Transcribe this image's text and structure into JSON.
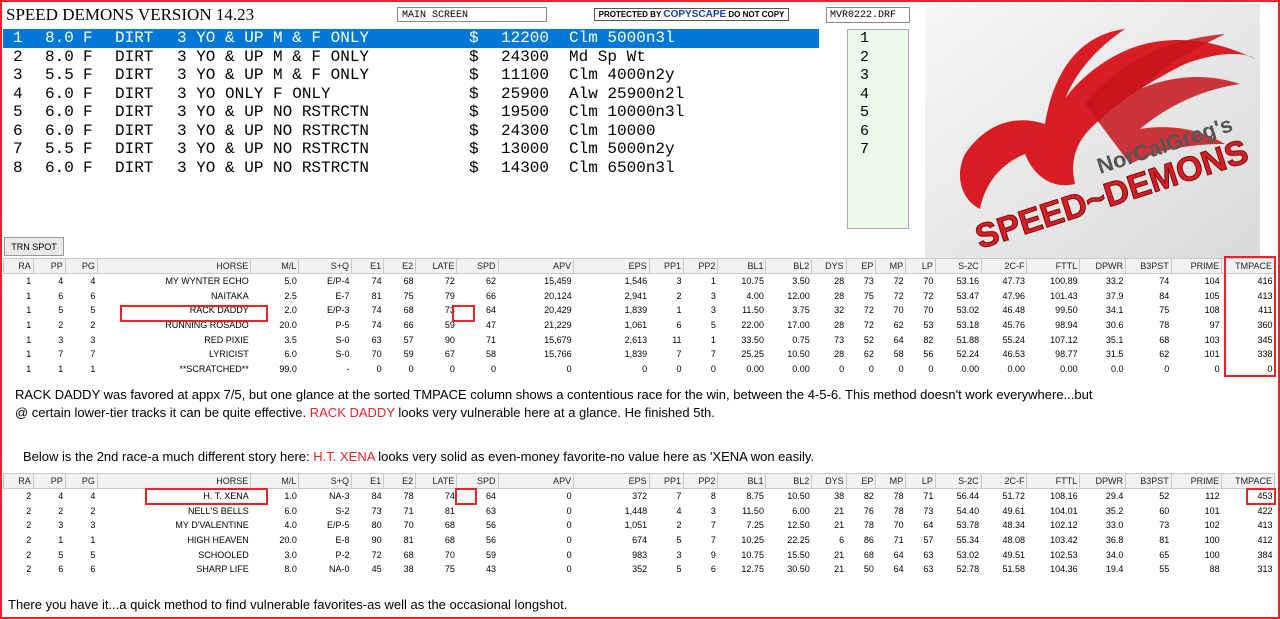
{
  "app": {
    "title": "SPEED DEMONS VERSION 14.23",
    "screen_label": "MAIN SCREEN",
    "protected_text_1": "PROTECTED BY ",
    "protected_brand": "COPYSCAPE",
    "protected_text_2": " DO NOT COPY",
    "file_name": "MVR0222.DRF"
  },
  "race_list": [
    {
      "num": "1",
      "dist": "8.0",
      "surf": "F",
      "track": "DIRT",
      "conditions": "3 YO & UP M & F ONLY",
      "cur": "$",
      "purse": "12200",
      "type": "Clm 5000n3l",
      "selected": true
    },
    {
      "num": "2",
      "dist": "8.0",
      "surf": "F",
      "track": "DIRT",
      "conditions": "3 YO & UP M & F ONLY",
      "cur": "$",
      "purse": "24300",
      "type": "Md Sp Wt",
      "selected": false
    },
    {
      "num": "3",
      "dist": "5.5",
      "surf": "F",
      "track": "DIRT",
      "conditions": "3 YO & UP M & F ONLY",
      "cur": "$",
      "purse": "11100",
      "type": "Clm 4000n2y",
      "selected": false
    },
    {
      "num": "4",
      "dist": "6.0",
      "surf": "F",
      "track": "DIRT",
      "conditions": "3 YO ONLY F ONLY",
      "cur": "$",
      "purse": "25900",
      "type": "Alw 25900n2l",
      "selected": false
    },
    {
      "num": "5",
      "dist": "6.0",
      "surf": "F",
      "track": "DIRT",
      "conditions": "3 YO & UP NO RSTRCTN",
      "cur": "$",
      "purse": "19500",
      "type": "Clm 10000n3l",
      "selected": false
    },
    {
      "num": "6",
      "dist": "6.0",
      "surf": "F",
      "track": "DIRT",
      "conditions": "3 YO & UP NO RSTRCTN",
      "cur": "$",
      "purse": "24300",
      "type": "Clm 10000",
      "selected": false
    },
    {
      "num": "7",
      "dist": "5.5",
      "surf": "F",
      "track": "DIRT",
      "conditions": "3 YO & UP NO RSTRCTN",
      "cur": "$",
      "purse": "13000",
      "type": "Clm 5000n2y",
      "selected": false
    },
    {
      "num": "8",
      "dist": "6.0",
      "surf": "F",
      "track": "DIRT",
      "conditions": "3 YO & UP NO RSTRCTN",
      "cur": "$",
      "purse": "14300",
      "type": "Clm 6500n3l",
      "selected": false
    }
  ],
  "number_list": [
    "1",
    "2",
    "3",
    "4",
    "5",
    "6",
    "7"
  ],
  "logo": {
    "line1": "NorCalGreg's",
    "line2": "SPEED~DEMONS",
    "accent": "#d81e24"
  },
  "trn_spot_label": "TRN SPOT",
  "columns": [
    "RA",
    "PP",
    "PG",
    "HORSE",
    "M/L",
    "S+Q",
    "E1",
    "E2",
    "LATE",
    "SPD",
    "APV",
    "EPS",
    "PP1",
    "PP2",
    "BL1",
    "BL2",
    "DYS",
    "EP",
    "MP",
    "LP",
    "S-2C",
    "2C-F",
    "FTTL",
    "DPWR",
    "B3PST",
    "PRIME",
    "TMPACE"
  ],
  "table1": [
    [
      "1",
      "4",
      "4",
      "MY WYNTER ECHO",
      "5.0",
      "E/P-4",
      "74",
      "68",
      "72",
      "62",
      "15,459",
      "1,546",
      "3",
      "1",
      "10.75",
      "3.50",
      "28",
      "73",
      "72",
      "70",
      "53.16",
      "47.73",
      "100.89",
      "33.2",
      "74",
      "104",
      "416"
    ],
    [
      "1",
      "6",
      "6",
      "NAITAKA",
      "2.5",
      "E-7",
      "81",
      "75",
      "79",
      "66",
      "20,124",
      "2,941",
      "2",
      "3",
      "4.00",
      "12.00",
      "28",
      "75",
      "72",
      "72",
      "53.47",
      "47.96",
      "101.43",
      "37.9",
      "84",
      "105",
      "413"
    ],
    [
      "1",
      "5",
      "5",
      "RACK DADDY",
      "2.0",
      "E/P-3",
      "74",
      "68",
      "73",
      "64",
      "20,429",
      "1,839",
      "1",
      "3",
      "11.50",
      "3.75",
      "32",
      "72",
      "70",
      "70",
      "53.02",
      "46.48",
      "99.50",
      "34.1",
      "75",
      "108",
      "411"
    ],
    [
      "1",
      "2",
      "2",
      "RUNNING ROSADO",
      "20.0",
      "P-5",
      "74",
      "66",
      "59",
      "47",
      "21,229",
      "1,061",
      "6",
      "5",
      "22.00",
      "17.00",
      "28",
      "72",
      "62",
      "53",
      "53.18",
      "45.76",
      "98.94",
      "30.6",
      "78",
      "97",
      "360"
    ],
    [
      "1",
      "3",
      "3",
      "RED PIXIE",
      "3.5",
      "S-0",
      "63",
      "57",
      "90",
      "71",
      "15,679",
      "2,613",
      "11",
      "1",
      "33.50",
      "0.75",
      "73",
      "52",
      "64",
      "82",
      "51.88",
      "55.24",
      "107.12",
      "35.1",
      "68",
      "103",
      "345"
    ],
    [
      "1",
      "7",
      "7",
      "LYRICIST",
      "6.0",
      "S-0",
      "70",
      "59",
      "67",
      "58",
      "15,766",
      "1,839",
      "7",
      "7",
      "25.25",
      "10.50",
      "28",
      "62",
      "58",
      "56",
      "52.24",
      "46.53",
      "98.77",
      "31.5",
      "62",
      "101",
      "338"
    ],
    [
      "1",
      "1",
      "1",
      "**SCRATCHED**",
      "99.0",
      "-",
      "0",
      "0",
      "0",
      "0",
      "0",
      "0",
      "0",
      "0",
      "0.00",
      "0.00",
      "0",
      "0",
      "0",
      "0",
      "0.00",
      "0.00",
      "0.00",
      "0.0",
      "0",
      "0",
      "0"
    ]
  ],
  "table2": [
    [
      "2",
      "4",
      "4",
      "H. T. XENA",
      "1.0",
      "NA-3",
      "84",
      "78",
      "74",
      "64",
      "0",
      "372",
      "7",
      "8",
      "8.75",
      "10.50",
      "38",
      "82",
      "78",
      "71",
      "56.44",
      "51.72",
      "108.16",
      "29.4",
      "52",
      "112",
      "453"
    ],
    [
      "2",
      "2",
      "2",
      "NELL'S BELLS",
      "6.0",
      "S-2",
      "73",
      "71",
      "81",
      "63",
      "0",
      "1,448",
      "4",
      "3",
      "11.50",
      "6.00",
      "21",
      "76",
      "78",
      "73",
      "54.40",
      "49.61",
      "104.01",
      "35.2",
      "60",
      "101",
      "422"
    ],
    [
      "2",
      "3",
      "3",
      "MY D'VALENTINE",
      "4.0",
      "E/P-5",
      "80",
      "70",
      "68",
      "56",
      "0",
      "1,051",
      "2",
      "7",
      "7.25",
      "12.50",
      "21",
      "78",
      "70",
      "64",
      "53.78",
      "48.34",
      "102.12",
      "33.0",
      "73",
      "102",
      "413"
    ],
    [
      "2",
      "1",
      "1",
      "HIGH HEAVEN",
      "20.0",
      "E-8",
      "90",
      "81",
      "68",
      "56",
      "0",
      "674",
      "5",
      "7",
      "10.25",
      "22.25",
      "6",
      "86",
      "71",
      "57",
      "55.34",
      "48.08",
      "103.42",
      "36.8",
      "81",
      "100",
      "412"
    ],
    [
      "2",
      "5",
      "5",
      "SCHOOLED",
      "3.0",
      "P-2",
      "72",
      "68",
      "70",
      "59",
      "0",
      "983",
      "3",
      "9",
      "10.75",
      "15.50",
      "21",
      "68",
      "64",
      "63",
      "53.02",
      "49.51",
      "102.53",
      "34.0",
      "65",
      "100",
      "384"
    ],
    [
      "2",
      "6",
      "6",
      "SHARP LIFE",
      "8.0",
      "NA-0",
      "45",
      "38",
      "75",
      "43",
      "0",
      "352",
      "5",
      "6",
      "12.75",
      "30.50",
      "21",
      "50",
      "64",
      "63",
      "52.78",
      "51.58",
      "104.36",
      "19.4",
      "55",
      "88",
      "313"
    ]
  ],
  "notes": {
    "p1_line1": "RACK DADDY was favored at appx 7/5, but one glance at the sorted TMPACE column shows a contentious race for the win, between the 4-5-6.  This method doesn't work everywhere...but",
    "p1_line2_a": "@ certain lower-tier tracks it can be quite effective.  ",
    "p1_line2_red": "RACK DADDY",
    "p1_line2_b": " looks very vulnerable here at a glance.  He finished 5th.",
    "p2_a": "Below is the 2nd race-a much different story here:  ",
    "p2_red": "H.T. XENA",
    "p2_b": " looks very solid as even-money favorite-no value here as 'XENA won easily.",
    "p3": "There you have it...a quick method to find vulnerable favorites-as well as the occasional longshot."
  },
  "colors": {
    "highlight": "#e8232a",
    "selection": "#0078d7"
  }
}
